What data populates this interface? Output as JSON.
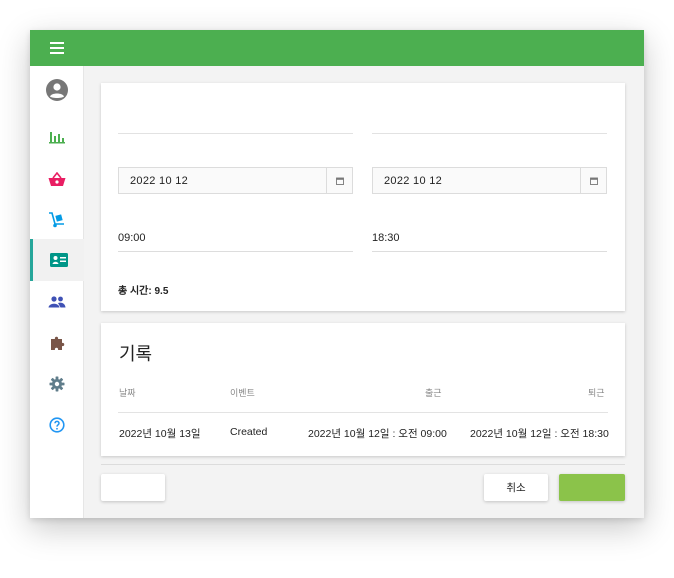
{
  "sidebar": {
    "items": [
      {
        "icon": "account-circle-icon",
        "color": "#777777"
      },
      {
        "icon": "bar-chart-icon",
        "color": "#4caf50"
      },
      {
        "icon": "shopping-basket-icon",
        "color": "#e91e63"
      },
      {
        "icon": "hand-truck-icon",
        "color": "#039be5"
      },
      {
        "icon": "id-card-icon",
        "color": "#009688",
        "active": true
      },
      {
        "icon": "people-icon",
        "color": "#3f51b5"
      },
      {
        "icon": "puzzle-icon",
        "color": "#795548"
      },
      {
        "icon": "gear-icon",
        "color": "#607d8b"
      },
      {
        "icon": "help-circle-icon",
        "color": "#2196f3"
      }
    ]
  },
  "form": {
    "start_date": "2022  10  12",
    "end_date": "2022  10  12",
    "start_time": "09:00",
    "end_time": "18:30",
    "total_hours": "총 시간: 9.5"
  },
  "records": {
    "title": "기록",
    "columns": [
      "날짜",
      "이벤트",
      "출근",
      "퇴근"
    ],
    "rows": [
      [
        "2022년 10월 13일",
        "Created",
        "2022년 10월 12일 : 오전 09:00",
        "2022년 10월 12일 : 오전 18:30"
      ]
    ]
  },
  "footer": {
    "left_button_label": "",
    "cancel_label": "취소",
    "confirm_label": ""
  },
  "colors": {
    "primary": "#4caf50",
    "confirm": "#8bc34a",
    "active_indicator": "#26a69a"
  }
}
